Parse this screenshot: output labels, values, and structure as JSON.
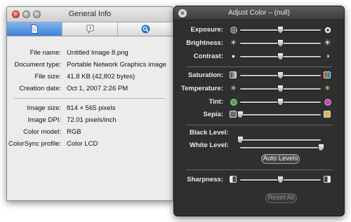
{
  "info_window": {
    "title": "General Info",
    "tabs": [
      {
        "icon": "document-icon",
        "active": true
      },
      {
        "icon": "info-icon",
        "active": false
      },
      {
        "icon": "magnifier-icon",
        "active": false
      }
    ],
    "rows": [
      {
        "label": "File name:",
        "value": "Untitled Image 8.png"
      },
      {
        "label": "Document type:",
        "value": "Portable Network Graphics image"
      },
      {
        "label": "File size:",
        "value": "41.8 KB (42,802 bytes)"
      },
      {
        "label": "Creation date:",
        "value": "Oct 1, 2007 2:26 PM"
      },
      {
        "label": "Image size:",
        "value": "814 × 565 pixels"
      },
      {
        "label": "Image DPI:",
        "value": "72.01 pixels/inch"
      },
      {
        "label": "Color model:",
        "value": "RGB"
      },
      {
        "label": "ColorSync profile:",
        "value": "Color LCD"
      }
    ]
  },
  "adjust_color": {
    "title": "Adjust Color – (null)",
    "sliders": [
      {
        "key": "exposure",
        "label": "Exposure:",
        "value": 0.5,
        "icon_left": "aperture-icon",
        "icon_right": "aperture-filled-icon"
      },
      {
        "key": "brightness",
        "label": "Brightness:",
        "value": 0.5,
        "icon_left": "sun-small-icon",
        "icon_right": "sun-large-icon"
      },
      {
        "key": "contrast",
        "label": "Contrast:",
        "value": 0.5,
        "icon_left": "circle-filled-icon",
        "icon_right": "circle-half-icon"
      },
      {
        "key": "saturation",
        "label": "Saturation:",
        "value": 0.5,
        "icon_left": "grayscale-icon",
        "icon_right": "color-bars-icon"
      },
      {
        "key": "temperature",
        "label": "Temperature:",
        "value": 0.5,
        "icon_left": "cool-sun-icon",
        "icon_right": "warm-sun-icon"
      },
      {
        "key": "tint",
        "label": "Tint:",
        "value": 0.5,
        "icon_left": "green-dot-icon",
        "icon_right": "magenta-dot-icon"
      },
      {
        "key": "sepia",
        "label": "Sepia:",
        "value": 0.0,
        "icon_left": "sepia-off-icon",
        "icon_right": "sepia-on-icon"
      },
      {
        "key": "black_level",
        "label": "Black Level:",
        "value": 0.0
      },
      {
        "key": "white_level",
        "label": "White Level:",
        "value": 1.0
      },
      {
        "key": "sharpness",
        "label": "Sharpness:",
        "value": 0.5,
        "icon_left": "soft-icon",
        "icon_right": "sharp-icon"
      }
    ],
    "auto_levels_label": "Auto Levels",
    "reset_all_label": "Reset All"
  },
  "colors": {
    "tab_active": "#3f81d8",
    "close_red": "#e0443e",
    "hud_background": "#262626",
    "tint_green": "#3fae3f",
    "tint_magenta": "#c23fc6",
    "sepia": "#e0b35a"
  }
}
